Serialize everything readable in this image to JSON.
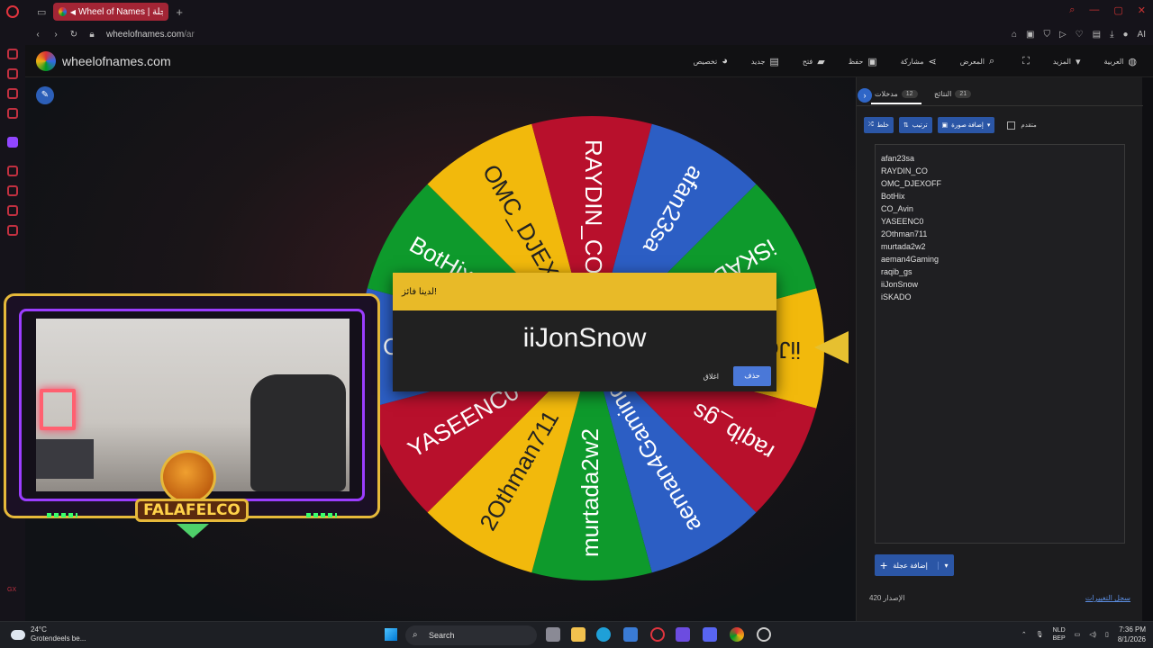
{
  "browser": {
    "tab_title": "Wheel of Names | عجلة...",
    "url_host": "wheelofnames.com",
    "url_path": "/ar"
  },
  "site": {
    "title": "wheelofnames.com",
    "menu": [
      {
        "label": "العربية",
        "icon": "globe-icon"
      },
      {
        "label": "المزيد",
        "icon": "caret-down-icon"
      },
      {
        "label": "",
        "icon": "fullscreen-icon"
      },
      {
        "label": "المعرض",
        "icon": "search-icon"
      },
      {
        "label": "مشاركة",
        "icon": "share-icon"
      },
      {
        "label": "حفظ",
        "icon": "save-icon"
      },
      {
        "label": "فتح",
        "icon": "folder-icon"
      },
      {
        "label": "جديد",
        "icon": "file-icon"
      },
      {
        "label": "تخصيص",
        "icon": "palette-icon"
      }
    ]
  },
  "wheel": {
    "segments": [
      {
        "name": "iiJonSnow",
        "color": "#f2b90c"
      },
      {
        "name": "raqib_gs",
        "color": "#b8102c"
      },
      {
        "name": "aeman4Gaming",
        "color": "#2c5ec4"
      },
      {
        "name": "murtada2w2",
        "color": "#0e9a2c"
      },
      {
        "name": "2Othman711",
        "color": "#f2b90c"
      },
      {
        "name": "YASEENC0",
        "color": "#b8102c"
      },
      {
        "name": "CO_Avin",
        "color": "#2c5ec4"
      },
      {
        "name": "BotHix",
        "color": "#0e9a2c"
      },
      {
        "name": "OMC_DJEXOFF",
        "color": "#f2b90c"
      },
      {
        "name": "RAYDIN_CO",
        "color": "#b8102c"
      },
      {
        "name": "afan23sa",
        "color": "#2c5ec4"
      },
      {
        "name": "iSKADO",
        "color": "#0e9a2c"
      }
    ]
  },
  "dialog": {
    "header": "لدينا فائز!",
    "winner": "iiJonSnow",
    "close_label": "اغلاق",
    "remove_label": "حذف"
  },
  "stream_overlay": {
    "brand": "FALAFELCO"
  },
  "panel": {
    "tab_entries_label": "مدخلات",
    "tab_entries_count": "12",
    "tab_results_label": "النتائج",
    "tab_results_count": "21",
    "shuffle_label": "خلط",
    "sort_label": "ترتيب",
    "add_image_label": "إضافة صورة",
    "advanced_label": "متقدم",
    "entries": [
      "afan23sa",
      "RAYDIN_CO",
      "OMC_DJEXOFF",
      "BotHix",
      "CO_Avin",
      "YASEENC0",
      "2Othman711",
      "murtada2w2",
      "aeman4Gaming",
      "raqib_gs",
      "iiJonSnow",
      "iSKADO"
    ],
    "add_wheel_label": "إضافة عجلة",
    "version_label": "الإصدار",
    "version_number": "420",
    "changelog_label": "سجل التغييرات"
  },
  "taskbar": {
    "weather_temp": "24°C",
    "weather_desc": "Grotendeels be...",
    "search_label": "Search",
    "lang_top": "NLD",
    "lang_bottom": "BEP",
    "time": "7:36 PM",
    "date": "8/1/2026"
  }
}
